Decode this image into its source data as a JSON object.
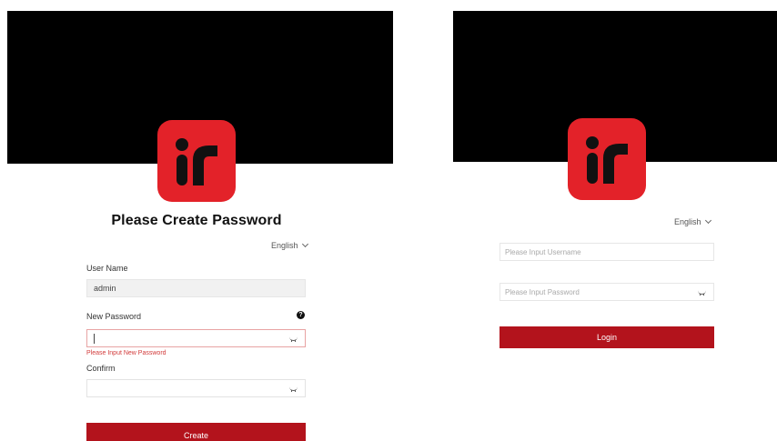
{
  "create_panel": {
    "logo_text": "iF",
    "title": "Please Create Password",
    "language": "English",
    "username_label": "User Name",
    "username_value": "admin",
    "new_password_label": "New Password",
    "new_password_error": "Please Input New Password",
    "confirm_label": "Confirm",
    "create_button": "Create"
  },
  "login_panel": {
    "logo_text": "iF",
    "language": "English",
    "username_placeholder": "Please Input Username",
    "password_placeholder": "Please Input Password",
    "login_button": "Login"
  },
  "colors": {
    "logo_red": "#e32229",
    "button_red": "#b3131c",
    "error_red": "#d23a3a",
    "hero_black": "#000000"
  },
  "icons": [
    "show-password-icon",
    "help-icon",
    "chevron-down-icon"
  ]
}
